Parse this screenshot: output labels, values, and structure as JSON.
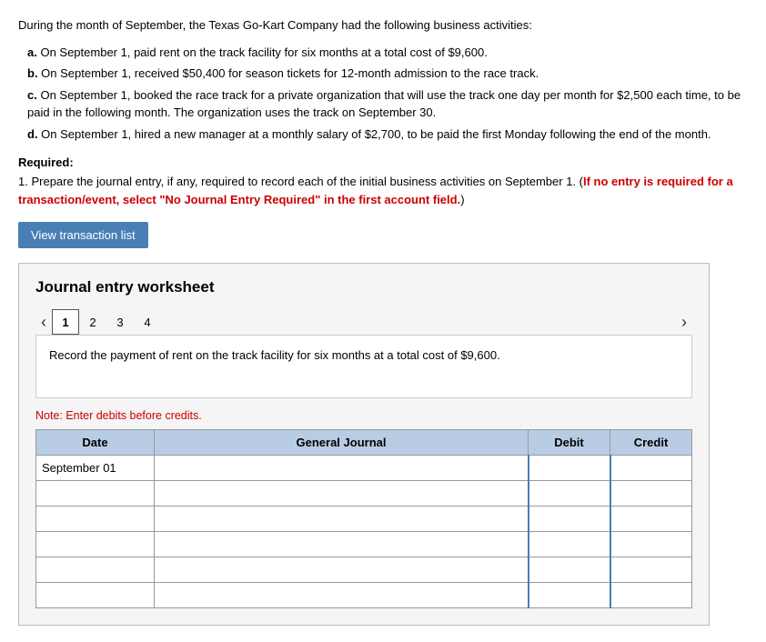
{
  "intro": {
    "text": "During the month of September, the Texas Go-Kart Company had the following business activities:"
  },
  "activities": [
    {
      "label": "a.",
      "text": "On September 1, paid rent on the track facility for six months at a total cost of $9,600."
    },
    {
      "label": "b.",
      "text": "On September 1, received $50,400 for season tickets for 12-month admission to the race track."
    },
    {
      "label": "c.",
      "text": "On September 1, booked the race track for a private organization that will use the track one day per month for $2,500 each time, to be paid in the following month. The organization uses the track on September 30."
    },
    {
      "label": "d.",
      "text": "On September 1, hired a new manager at a monthly salary of $2,700, to be paid the first Monday following the end of the month."
    }
  ],
  "required": {
    "label": "Required:",
    "number": "1.",
    "text_plain": "Prepare the journal entry, if any, required to record each of the initial business activities on September 1. (",
    "text_red": "If no entry is required for a transaction/event, select \"No Journal Entry Required\" in the first account field.",
    "text_red2": ")"
  },
  "btn_label": "View transaction list",
  "worksheet": {
    "title": "Journal entry worksheet",
    "pages": [
      "1",
      "2",
      "3",
      "4"
    ],
    "active_page": "1",
    "record_description": "Record the payment of rent on the track facility for six months at a total cost of $9,600.",
    "note": "Note: Enter debits before credits.",
    "table": {
      "headers": {
        "date": "Date",
        "general_journal": "General Journal",
        "debit": "Debit",
        "credit": "Credit"
      },
      "rows": [
        {
          "date": "September 01",
          "journal": "",
          "debit": "",
          "credit": ""
        },
        {
          "date": "",
          "journal": "",
          "debit": "",
          "credit": ""
        },
        {
          "date": "",
          "journal": "",
          "debit": "",
          "credit": ""
        },
        {
          "date": "",
          "journal": "",
          "debit": "",
          "credit": ""
        },
        {
          "date": "",
          "journal": "",
          "debit": "",
          "credit": ""
        },
        {
          "date": "",
          "journal": "",
          "debit": "",
          "credit": ""
        }
      ]
    }
  }
}
